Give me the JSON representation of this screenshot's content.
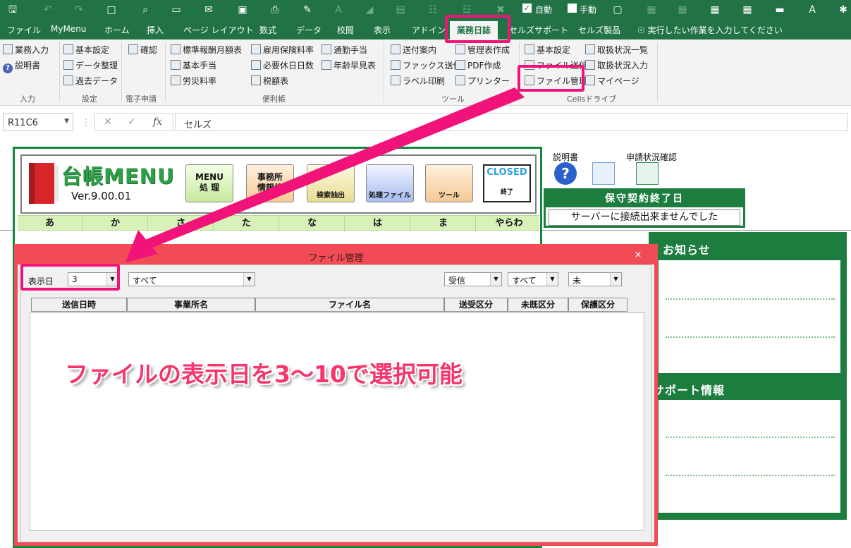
{
  "qat": {
    "auto_label": "自動",
    "manual_label": "手動",
    "auto_checked": true,
    "manual_checked": false
  },
  "tabs": [
    {
      "label": "ファイル"
    },
    {
      "label": "MyMenu"
    },
    {
      "label": "ホーム"
    },
    {
      "label": "挿入"
    },
    {
      "label": "ページ レイアウト"
    },
    {
      "label": "数式"
    },
    {
      "label": "データ"
    },
    {
      "label": "校閲"
    },
    {
      "label": "表示"
    },
    {
      "label": "アドイン"
    },
    {
      "label": "業務日誌"
    },
    {
      "label": "セルズサポート"
    },
    {
      "label": "セルズ製品"
    },
    {
      "label": "実行したい作業を入力してください"
    }
  ],
  "ribbon": {
    "input": {
      "items": [
        "業務入力",
        "説明書"
      ],
      "group": "入力"
    },
    "settings": {
      "items": [
        "基本設定",
        "データ整理",
        "過去データ"
      ],
      "group": "設定"
    },
    "e_filing": {
      "items": [
        "確認"
      ],
      "group": "電子申請"
    },
    "tables": {
      "col1": [
        "標準報酬月額表",
        "基本手当",
        "労災料率"
      ],
      "col2": [
        "雇用保険料率",
        "必要休日日数",
        "税額表"
      ],
      "col3": [
        "通勤手当",
        "年齢早見表"
      ],
      "group": "便利帳"
    },
    "tools": {
      "col1": [
        "送付案内",
        "ファックス送信",
        "ラベル印刷"
      ],
      "col2": [
        "管理表作成",
        "PDF作成",
        "プリンター"
      ],
      "group": "ツール"
    },
    "drive": {
      "col1": [
        "基本設定",
        "ファイル送信",
        "ファイル管理"
      ],
      "col2": [
        "取扱状況一覧",
        "取扱状況入力",
        "マイページ"
      ],
      "group": "Cellsドライブ"
    }
  },
  "formula_bar": {
    "name_box": "R11C6",
    "fx": "fx",
    "content": "セルズ"
  },
  "menu": {
    "title": "台帳MENU",
    "version": "Ver.9.00.01",
    "buttons": [
      {
        "line1": "MENU",
        "line2": "処 理"
      },
      {
        "line1": "事務所",
        "line2": "情報他"
      },
      {
        "line1": "検索抽出"
      },
      {
        "line1": "処理ファイル"
      },
      {
        "line1": "ツール"
      },
      {
        "line1": "CLOSED",
        "line2": "終了"
      }
    ],
    "kana": [
      "あ",
      "か",
      "さ",
      "た",
      "な",
      "は",
      "ま",
      "やらわ"
    ]
  },
  "right_panel": {
    "manual_label": "説明書",
    "status_label": "申請状況確認",
    "expiry_title": "保守契約終了日",
    "expiry_value": "サーバーに接続出来ませんでした",
    "news_title": "お知らせ",
    "support_title": "サポート情報"
  },
  "dialog": {
    "title": "ファイル管理",
    "close": "×",
    "days_label": "表示日",
    "days_value": "3",
    "office_value": "すべて",
    "direction_value": "受信",
    "filter_value": "すべて",
    "read_value": "未",
    "columns": [
      "送信日時",
      "事業所名",
      "ファイル名",
      "送受区分",
      "未既区分",
      "保護区分"
    ]
  },
  "annotation": {
    "callout": "ファイルの表示日を3～10で選択可能"
  },
  "colors": {
    "excel_green": "#217346",
    "highlight_pink": "#f1137a",
    "dialog_red": "#f14b55"
  }
}
